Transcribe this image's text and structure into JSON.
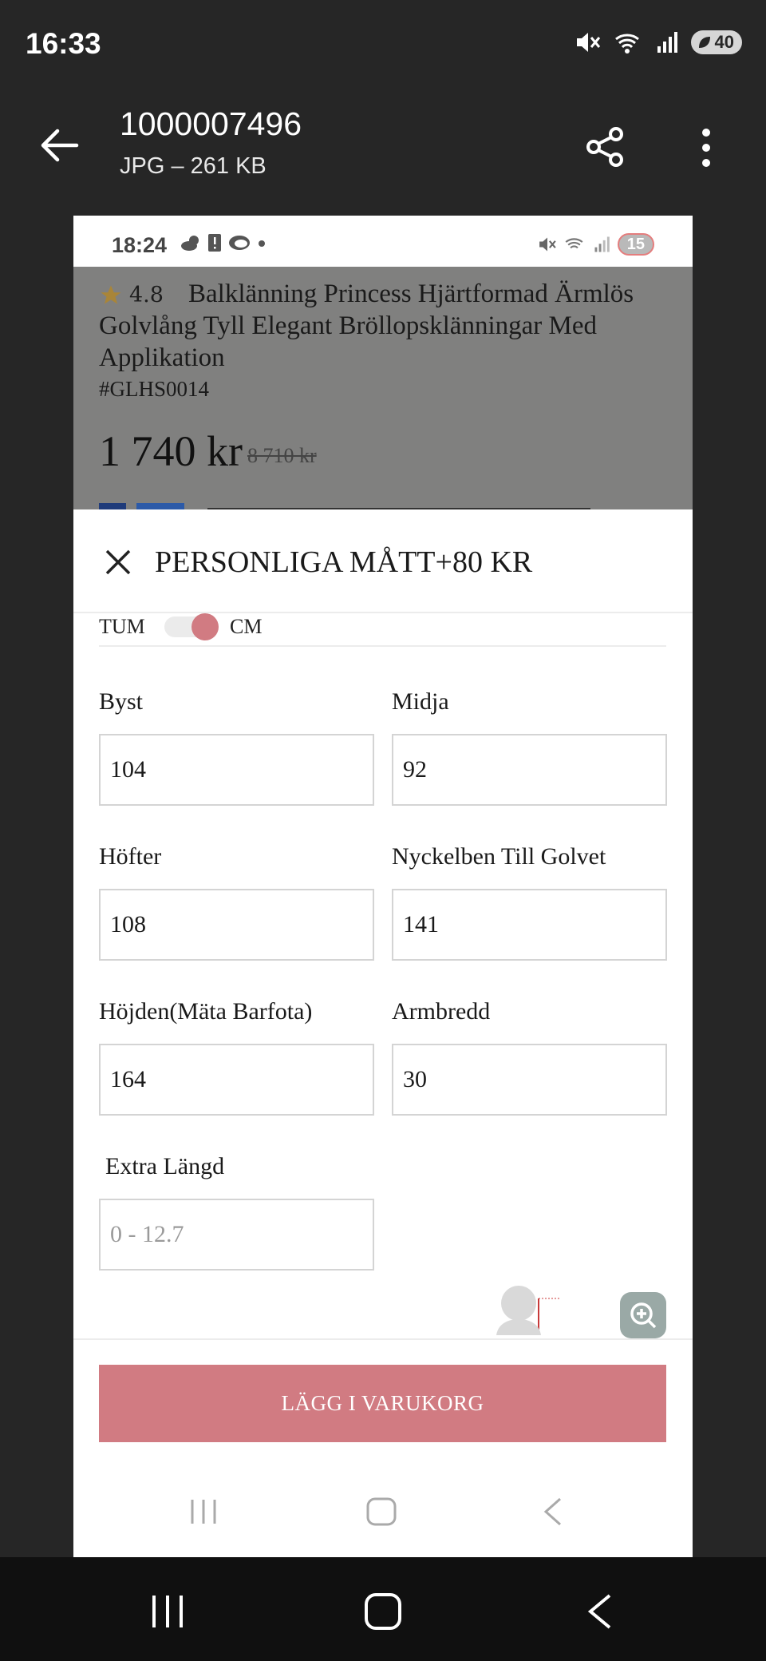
{
  "outer_status": {
    "time": "16:33",
    "signal_tag": "6",
    "battery": "40"
  },
  "viewer": {
    "file_name": "1000007496",
    "file_info": "JPG – 261 KB"
  },
  "inner_status": {
    "time": "18:24",
    "battery": "15"
  },
  "product": {
    "rating": "4.8",
    "title": "Balklänning Princess Hjärtformad Ärmlös Golvlång Tyll Elegant Bröllopsklänningar Med Applikation",
    "sku": "#GLHS0014",
    "price": "1 740 kr",
    "old_price": "8 710 kr"
  },
  "sheet": {
    "title": "PERSONLIGA MÅTT+80 KR",
    "unit_left": "TUM",
    "unit_right": "CM",
    "unit_selected": "CM",
    "fields": [
      {
        "label": "Byst",
        "value": "104"
      },
      {
        "label": "Midja",
        "value": "92"
      },
      {
        "label": "Höfter",
        "value": "108"
      },
      {
        "label": "Nyckelben Till Golvet",
        "value": "141"
      },
      {
        "label": "Höjden(Mäta Barfota)",
        "value": "164"
      },
      {
        "label": "Armbredd",
        "value": "30"
      }
    ],
    "extra": {
      "label": "Extra Längd",
      "placeholder": "0 - 12.7"
    },
    "cart_button": "LÄGG I VARUKORG"
  },
  "colors": {
    "accent": "#d17b82",
    "overlay": "#80807f",
    "outer_bg": "#262626"
  },
  "icons": [
    "back-arrow-icon",
    "share-icon",
    "more-vert-icon",
    "close-icon",
    "zoom-icon",
    "star-icon",
    "recents-icon",
    "home-icon",
    "back-icon"
  ]
}
